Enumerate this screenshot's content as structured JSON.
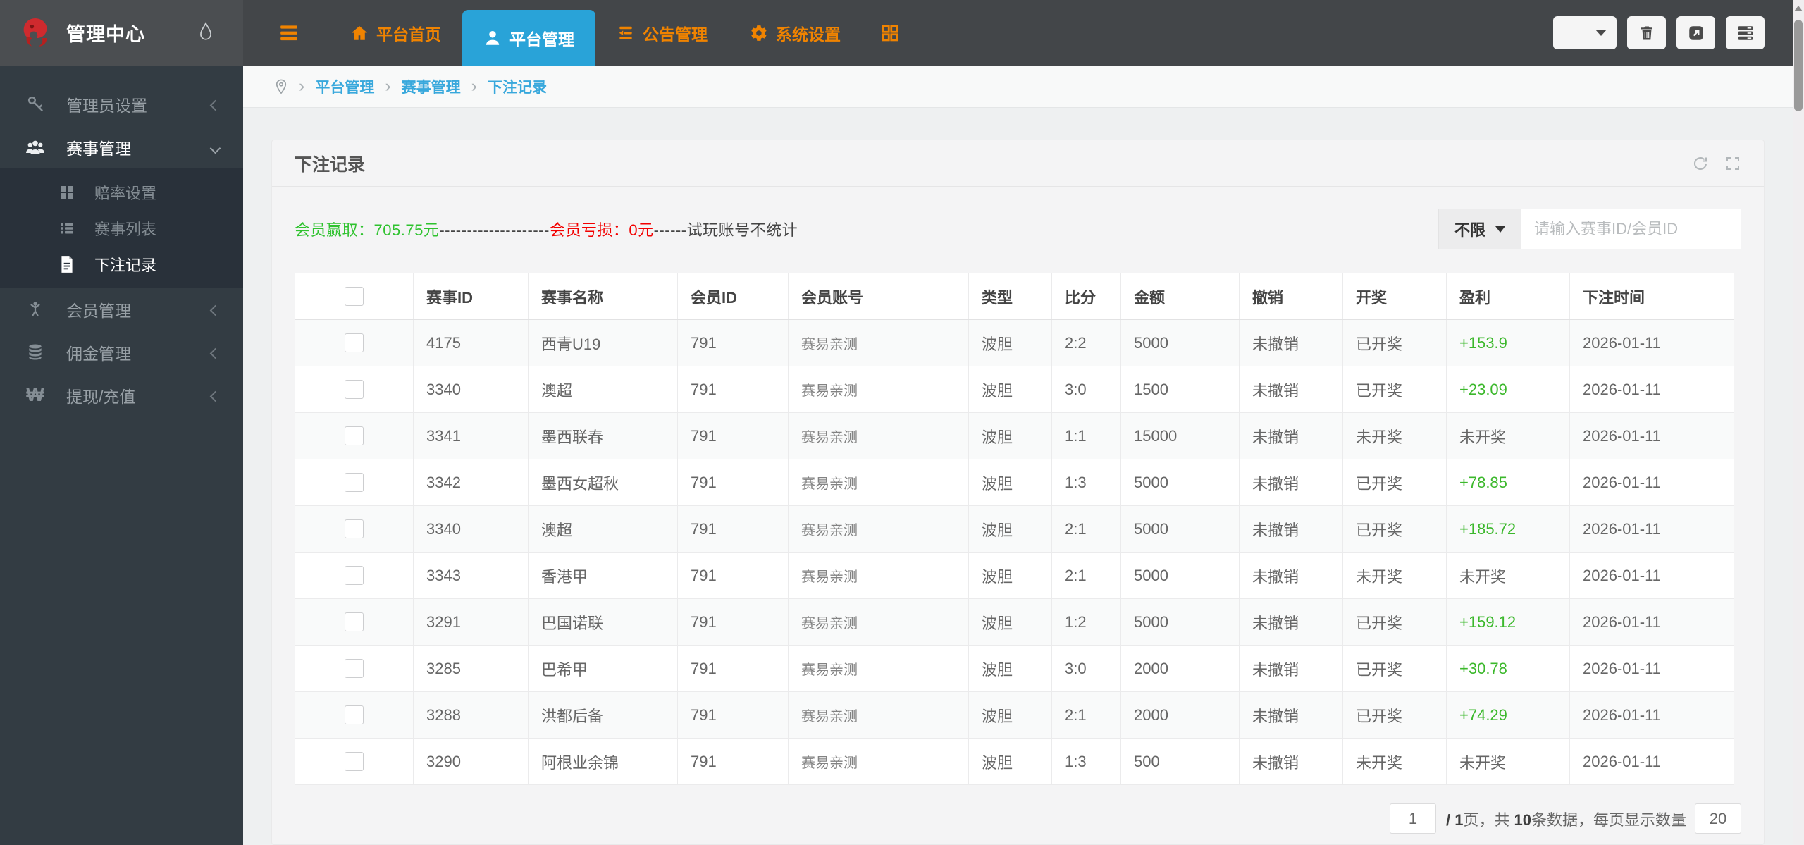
{
  "topbar": {
    "brand": "管理中心",
    "nav": [
      {
        "label": "平台首页",
        "icon": "home-icon",
        "active": false
      },
      {
        "label": "平台管理",
        "icon": "user-icon",
        "active": true
      },
      {
        "label": "公告管理",
        "icon": "announcement-icon",
        "active": false
      },
      {
        "label": "系统设置",
        "icon": "gear-icon",
        "active": false
      }
    ]
  },
  "sidebar": {
    "items": [
      {
        "label": "管理员设置",
        "icon": "key-icon",
        "state": "collapsed"
      },
      {
        "label": "赛事管理",
        "icon": "users-icon",
        "state": "expanded",
        "children": [
          {
            "label": "赔率设置",
            "icon": "grid-icon",
            "active": false
          },
          {
            "label": "赛事列表",
            "icon": "list-icon",
            "active": false
          },
          {
            "label": "下注记录",
            "icon": "file-icon",
            "active": true
          }
        ]
      },
      {
        "label": "会员管理",
        "icon": "person-icon",
        "state": "collapsed"
      },
      {
        "label": "佣金管理",
        "icon": "database-icon",
        "state": "collapsed"
      },
      {
        "label": "提现/充值",
        "icon": "won-icon",
        "state": "collapsed"
      }
    ]
  },
  "breadcrumb": {
    "separator": "›",
    "items": [
      "平台管理",
      "赛事管理",
      "下注记录"
    ]
  },
  "panel": {
    "title": "下注记录",
    "stats": {
      "win_label": "会员赢取：",
      "win_value": "705.75元",
      "dashes1": "--------------------",
      "loss_label": "会员亏损：",
      "loss_value": "0元",
      "dashes2": "------",
      "note": "试玩账号不统计"
    },
    "filter": {
      "type_button": "不限",
      "search_placeholder": "请输入赛事ID/会员ID"
    }
  },
  "table": {
    "headers": [
      "赛事ID",
      "赛事名称",
      "会员ID",
      "会员账号",
      "类型",
      "比分",
      "金额",
      "撤销",
      "开奖",
      "盈利",
      "下注时间"
    ],
    "rows": [
      [
        "4175",
        "西青U19",
        "791",
        "赛易亲测",
        "波胆",
        "2:2",
        "5000",
        "未撤销",
        "已开奖",
        "+153.9",
        "2026-01-11"
      ],
      [
        "3340",
        "澳超",
        "791",
        "赛易亲测",
        "波胆",
        "3:0",
        "1500",
        "未撤销",
        "已开奖",
        "+23.09",
        "2026-01-11"
      ],
      [
        "3341",
        "墨西联春",
        "791",
        "赛易亲测",
        "波胆",
        "1:1",
        "15000",
        "未撤销",
        "未开奖",
        "未开奖",
        "2026-01-11"
      ],
      [
        "3342",
        "墨西女超秋",
        "791",
        "赛易亲测",
        "波胆",
        "1:3",
        "5000",
        "未撤销",
        "已开奖",
        "+78.85",
        "2026-01-11"
      ],
      [
        "3340",
        "澳超",
        "791",
        "赛易亲测",
        "波胆",
        "2:1",
        "5000",
        "未撤销",
        "已开奖",
        "+185.72",
        "2026-01-11"
      ],
      [
        "3343",
        "香港甲",
        "791",
        "赛易亲测",
        "波胆",
        "2:1",
        "5000",
        "未撤销",
        "未开奖",
        "未开奖",
        "2026-01-11"
      ],
      [
        "3291",
        "巴国诺联",
        "791",
        "赛易亲测",
        "波胆",
        "1:2",
        "5000",
        "未撤销",
        "已开奖",
        "+159.12",
        "2026-01-11"
      ],
      [
        "3285",
        "巴希甲",
        "791",
        "赛易亲测",
        "波胆",
        "3:0",
        "2000",
        "未撤销",
        "已开奖",
        "+30.78",
        "2026-01-11"
      ],
      [
        "3288",
        "洪都后备",
        "791",
        "赛易亲测",
        "波胆",
        "2:1",
        "2000",
        "未撤销",
        "已开奖",
        "+74.29",
        "2026-01-11"
      ],
      [
        "3290",
        "阿根业余锦",
        "791",
        "赛易亲测",
        "波胆",
        "1:3",
        "500",
        "未撤销",
        "未开奖",
        "未开奖",
        "2026-01-11"
      ]
    ]
  },
  "pagination": {
    "page_input": "1",
    "slash_page": "/ 1",
    "page_word": "页，共",
    "total": "10",
    "tail": "条数据，每页显示数量",
    "per_page": "20"
  },
  "colors": {
    "accent_orange": "#f08300",
    "active_tab_blue": "#29a3d8",
    "breadcrumb_link": "#38a8dc",
    "stats_green": "#2ec22e",
    "stats_red": "#f20000",
    "profit_green": "#3cb82c",
    "topbar_bg": "#434649",
    "sidebar_bg": "#333c43",
    "logo_red": "#cf2a2e"
  }
}
